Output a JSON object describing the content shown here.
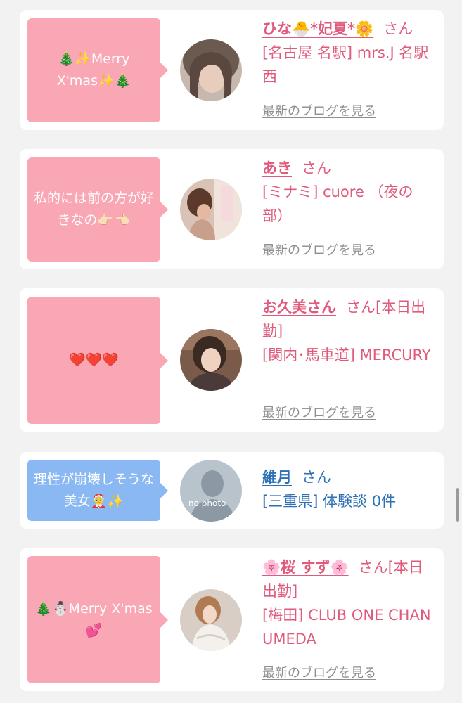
{
  "entries": [
    {
      "bubble": "🎄✨Merry X'mas✨🎄",
      "bubble_color": "#f9a7b5",
      "name": "ひな🐣*妃夏*🌼",
      "suffix": "さん",
      "shop": "[名古屋 名駅] mrs.J 名駅西",
      "blog_link": "最新のブログを見る"
    },
    {
      "bubble": "私的には前の方が好きなの👉🏻👈🏻",
      "bubble_color": "#f9a7b5",
      "name": "あき",
      "suffix": "さん",
      "shop": "[ミナミ] cuore （夜の部）",
      "blog_link": "最新のブログを見る"
    },
    {
      "bubble": "❤️❤️❤️",
      "bubble_color": "#f9a7b5",
      "name": "お久美さん",
      "suffix": "さん[本日出勤]",
      "shop": "[関内･馬車道] MERCURY",
      "blog_link": "最新のブログを見る"
    },
    {
      "bubble": "理性が崩壊しそうな美女🤶✨",
      "bubble_color": "#8ab8f2",
      "name": "維月",
      "suffix": "さん",
      "shop": "[三重県] 体験談 0件",
      "avatar_caption": "no photo"
    },
    {
      "bubble": "🎄☃️Merry X'mas💕",
      "bubble_color": "#f9a7b5",
      "name": "🌸桜 すず🌸",
      "suffix": "さん[本日出勤]",
      "shop": "[梅田] CLUB ONE CHAN UMEDA",
      "blog_link": "最新のブログを見る"
    }
  ],
  "colors": {
    "pink_text": "#e05a7c",
    "blue_text": "#2d6fb5",
    "link_gray": "#8e8e8e",
    "background": "#f2f2f2"
  }
}
